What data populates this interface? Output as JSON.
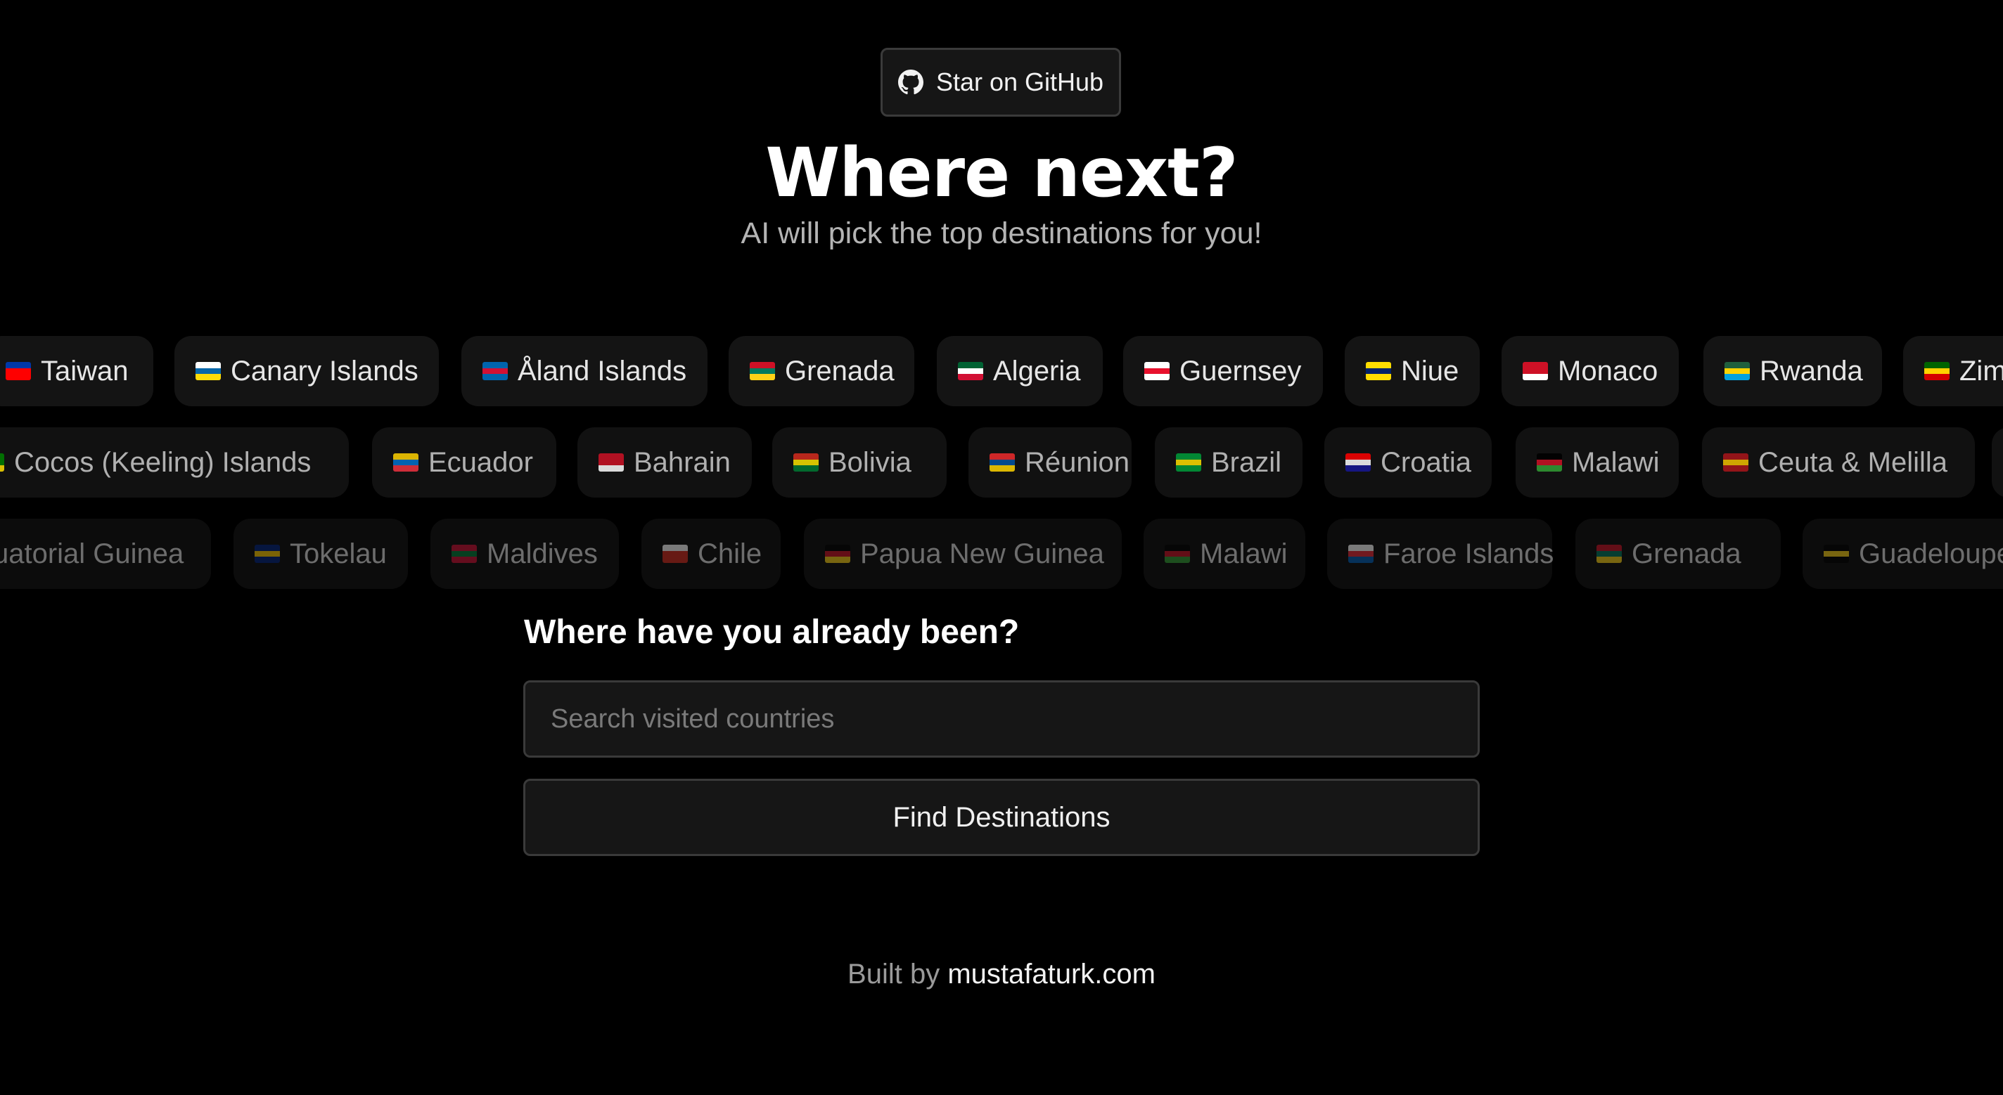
{
  "header": {
    "github_label": "Star on GitHub",
    "github_icon": "github-icon",
    "title": "Where next?",
    "subtitle": "AI will pick the top destinations for you!"
  },
  "marquee": {
    "rows": [
      [
        {
          "name": "Taiwan",
          "flag": [
            "#0038a8",
            "#fe0000",
            "#fe0000"
          ]
        },
        {
          "name": "Canary Islands",
          "flag": [
            "#ffffff",
            "#0768a9",
            "#fcdd09"
          ]
        },
        {
          "name": "Åland Islands",
          "flag": [
            "#0064ad",
            "#d21034",
            "#0064ad"
          ]
        },
        {
          "name": "Grenada",
          "flag": [
            "#ce1126",
            "#007a5e",
            "#fcd116"
          ]
        },
        {
          "name": "Algeria",
          "flag": [
            "#006233",
            "#ffffff",
            "#d21034"
          ]
        },
        {
          "name": "Guernsey",
          "flag": [
            "#ffffff",
            "#e8112d",
            "#ffffff"
          ]
        },
        {
          "name": "Niue",
          "flag": [
            "#fedd00",
            "#012169",
            "#fedd00"
          ]
        },
        {
          "name": "Monaco",
          "flag": [
            "#ce1126",
            "#ce1126",
            "#ffffff"
          ]
        },
        {
          "name": "Rwanda",
          "flag": [
            "#20603d",
            "#fad201",
            "#00a1de"
          ]
        },
        {
          "name": "Zimbabwe",
          "flag": [
            "#006400",
            "#ffd200",
            "#d40000"
          ]
        }
      ],
      [
        {
          "name": "Cocos (Keeling) Islands",
          "flag": [
            "#008000",
            "#008000",
            "#ffe000"
          ]
        },
        {
          "name": "Ecuador",
          "flag": [
            "#ffd100",
            "#0072ce",
            "#ef3340"
          ]
        },
        {
          "name": "Bahrain",
          "flag": [
            "#ce1126",
            "#ce1126",
            "#ffffff"
          ]
        },
        {
          "name": "Bolivia",
          "flag": [
            "#d52b1e",
            "#f9e300",
            "#007934"
          ]
        },
        {
          "name": "Réunion",
          "flag": [
            "#ef2b2d",
            "#0055a4",
            "#ffd500"
          ]
        },
        {
          "name": "Brazil",
          "flag": [
            "#009c3b",
            "#ffdf00",
            "#009c3b"
          ]
        },
        {
          "name": "Croatia",
          "flag": [
            "#ff0000",
            "#ffffff",
            "#171796"
          ]
        },
        {
          "name": "Malawi",
          "flag": [
            "#000000",
            "#ce1126",
            "#339e35"
          ]
        },
        {
          "name": "Ceuta & Melilla",
          "flag": [
            "#aa151b",
            "#f1bf00",
            "#aa151b"
          ]
        },
        {
          "name": "",
          "flag": [
            "#141414",
            "#141414",
            "#141414"
          ]
        }
      ],
      [
        {
          "name": "uatorial Guinea",
          "flag": []
        },
        {
          "name": "Tokelau",
          "flag": [
            "#00247d",
            "#ffce00",
            "#00247d"
          ]
        },
        {
          "name": "Maldives",
          "flag": [
            "#d21034",
            "#007e3a",
            "#d21034"
          ]
        },
        {
          "name": "Chile",
          "flag": [
            "#ffffff",
            "#d52b1e",
            "#d52b1e"
          ]
        },
        {
          "name": "Papua New Guinea",
          "flag": [
            "#000000",
            "#ce1126",
            "#fcd116"
          ]
        },
        {
          "name": "Malawi",
          "flag": [
            "#000000",
            "#ce1126",
            "#339e35"
          ]
        },
        {
          "name": "Faroe Islands",
          "flag": [
            "#ffffff",
            "#ed2939",
            "#005eb8"
          ]
        },
        {
          "name": "Grenada",
          "flag": [
            "#ce1126",
            "#007a5e",
            "#fcd116"
          ]
        },
        {
          "name": "Guadeloupe",
          "flag": [
            "#000000",
            "#fcd116",
            "#000000"
          ]
        }
      ]
    ]
  },
  "form": {
    "question": "Where have you already been?",
    "search_placeholder": "Search visited countries",
    "search_value": "",
    "find_button": "Find Destinations"
  },
  "footer": {
    "prefix": "Built by ",
    "link_text": "mustafaturk.com"
  },
  "colors": {
    "background": "#000000",
    "chip": "#141414",
    "border": "#3a3a3a"
  }
}
